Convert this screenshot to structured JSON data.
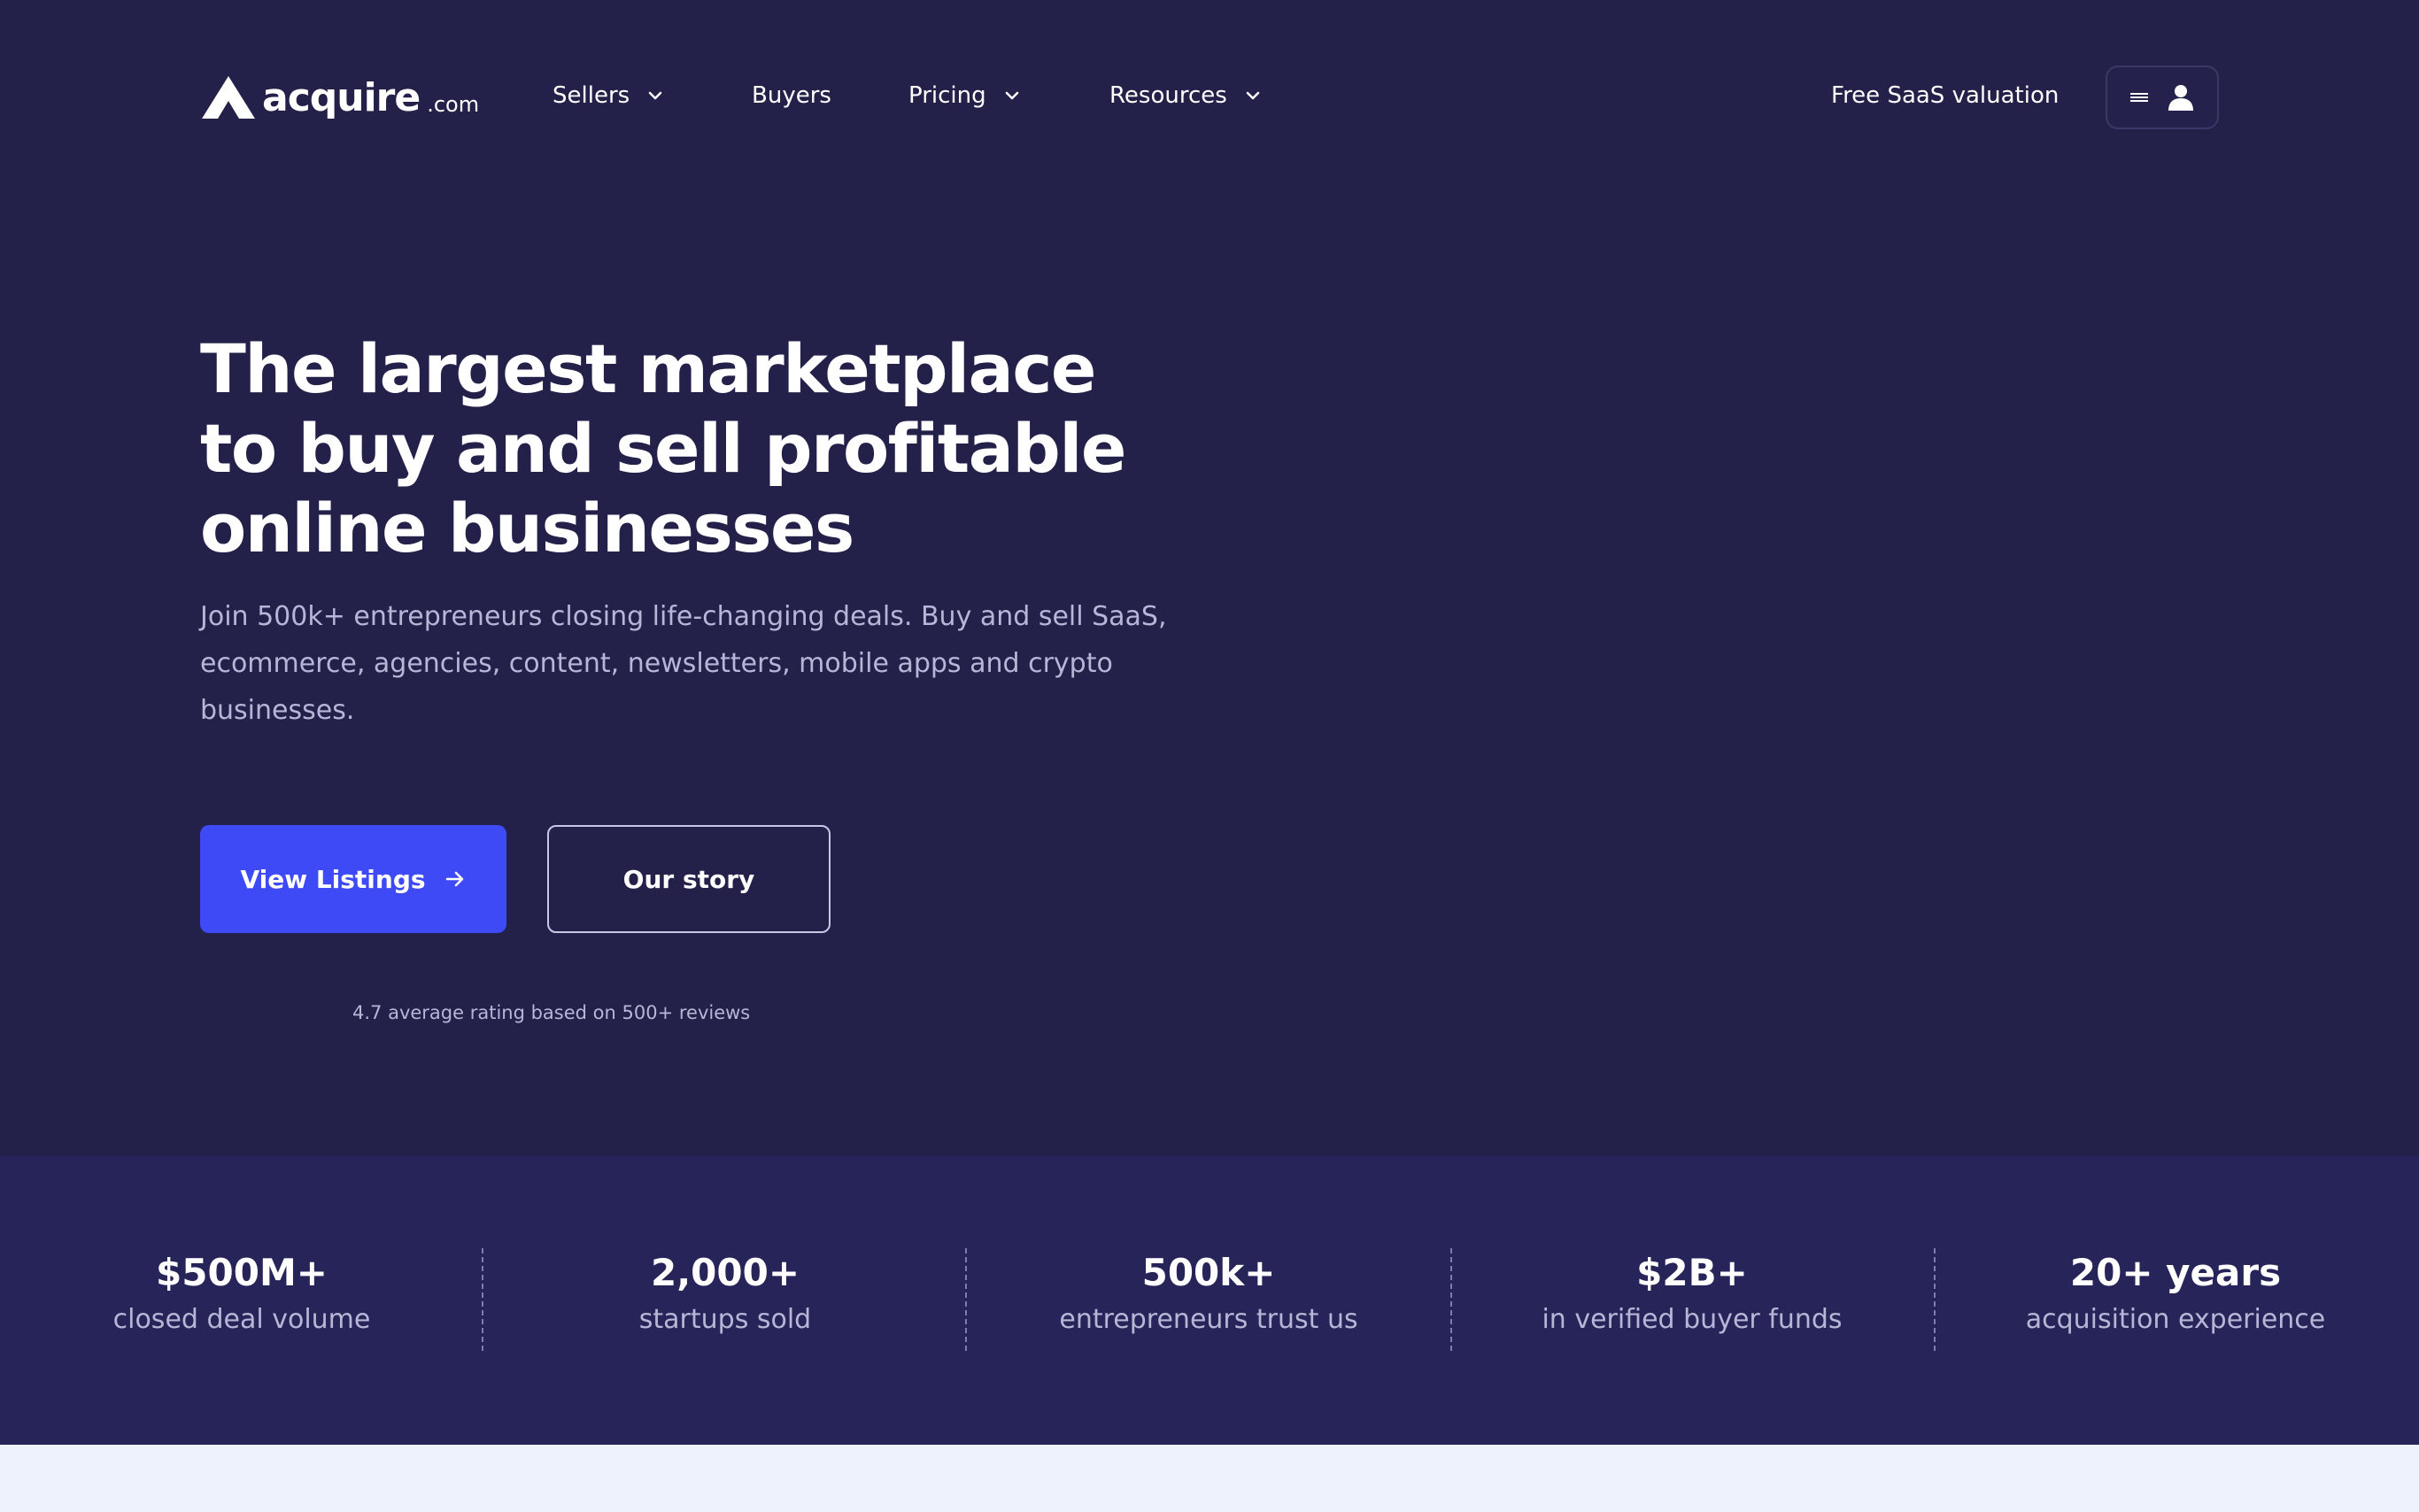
{
  "brand": {
    "name": "acquire",
    "tld": ".com"
  },
  "nav": {
    "items": [
      {
        "label": "Sellers",
        "has_dropdown": true
      },
      {
        "label": "Buyers",
        "has_dropdown": false
      },
      {
        "label": "Pricing",
        "has_dropdown": true
      },
      {
        "label": "Resources",
        "has_dropdown": true
      }
    ],
    "valuation_link": "Free SaaS valuation",
    "account_icons": [
      "menu-icon",
      "user-icon"
    ]
  },
  "hero": {
    "title": "The largest marketplace to buy and sell profitable online businesses",
    "subtitle": "Join 500k+ entrepreneurs closing life-changing deals. Buy and sell SaaS, ecommerce, agencies, content, newsletters, mobile apps and crypto businesses.",
    "primary_button": "View Listings",
    "secondary_button": "Our story",
    "rating": "4.7 average rating based on 500+ reviews"
  },
  "stats": [
    {
      "value": "$500M+",
      "label": "closed deal volume"
    },
    {
      "value": "2,000+",
      "label": "startups sold"
    },
    {
      "value": "500k+",
      "label": "entrepreneurs trust us"
    },
    {
      "value": "$2B+",
      "label": "in verified buyer funds"
    },
    {
      "value": "20+ years",
      "label": "acquisition experience"
    }
  ],
  "colors": {
    "background": "#23214a",
    "stats_band": "#27245a",
    "primary_button": "#3d4af5",
    "muted_text": "#b7b6d6",
    "bottom_section": "#eef2fd"
  }
}
